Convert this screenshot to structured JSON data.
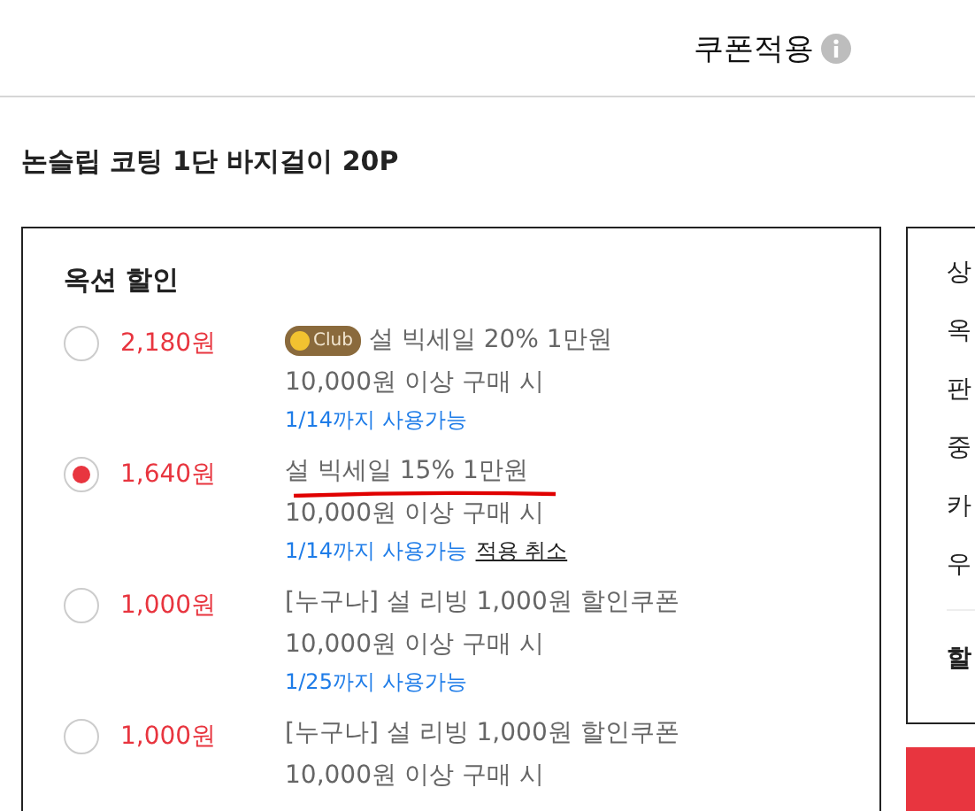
{
  "header": {
    "title": "쿠폰적용"
  },
  "product": {
    "name": "논슬립 코팅 1단 바지걸이 20P"
  },
  "option_discount": {
    "heading": "옥션 할인",
    "coupons": [
      {
        "price": "2,180원",
        "badge": "Club",
        "name": "설 빅세일 20% 1만원",
        "condition": "10,000원 이상 구매 시",
        "expiry": "1/14까지 사용가능",
        "selected": false
      },
      {
        "price": "1,640원",
        "name": "설 빅세일 15% 1만원",
        "condition": "10,000원 이상 구매 시",
        "expiry": "1/14까지 사용가능",
        "action": "적용 취소",
        "selected": true
      },
      {
        "price": "1,000원",
        "name": "[누구나] 설 리빙 1,000원 할인쿠폰",
        "condition": "10,000원 이상 구매 시",
        "expiry": "1/25까지 사용가능",
        "selected": false
      },
      {
        "price": "1,000원",
        "name": "[누구나] 설 리빙 1,000원 할인쿠폰",
        "condition": "10,000원 이상 구매 시",
        "selected": false
      }
    ]
  },
  "summary": {
    "rows": [
      "상",
      "옥",
      "판",
      "중",
      "카",
      "우"
    ],
    "total_label": "할"
  }
}
